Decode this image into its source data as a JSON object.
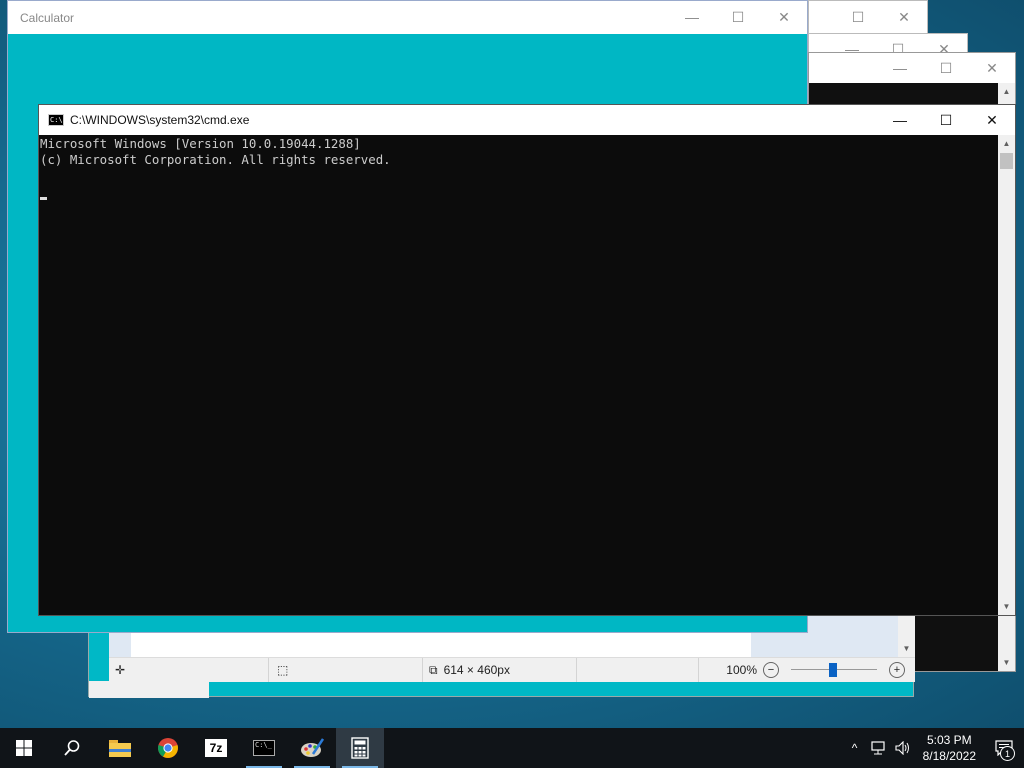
{
  "calculator": {
    "title": "Calculator"
  },
  "cmd": {
    "title": "C:\\WINDOWS\\system32\\cmd.exe",
    "lines": [
      "Microsoft Windows [Version 10.0.19044.1288]",
      "(c) Microsoft Corporation. All rights reserved."
    ]
  },
  "paint": {
    "size_text": "614 × 460px",
    "zoom": "100%"
  },
  "taskbar": {
    "apps": [
      "start",
      "search",
      "file-explorer",
      "chrome",
      "7-zip",
      "command-prompt",
      "paint",
      "calculator"
    ],
    "time": "5:03 PM",
    "date": "8/18/2022",
    "notification_count": "1"
  },
  "colors": {
    "calculator_accent": "#00b7c4",
    "console_bg": "#0c0c0c",
    "taskbar_bg": "#101418"
  },
  "icons": {
    "minimize": "—",
    "maximize": "☐",
    "close": "✕"
  }
}
